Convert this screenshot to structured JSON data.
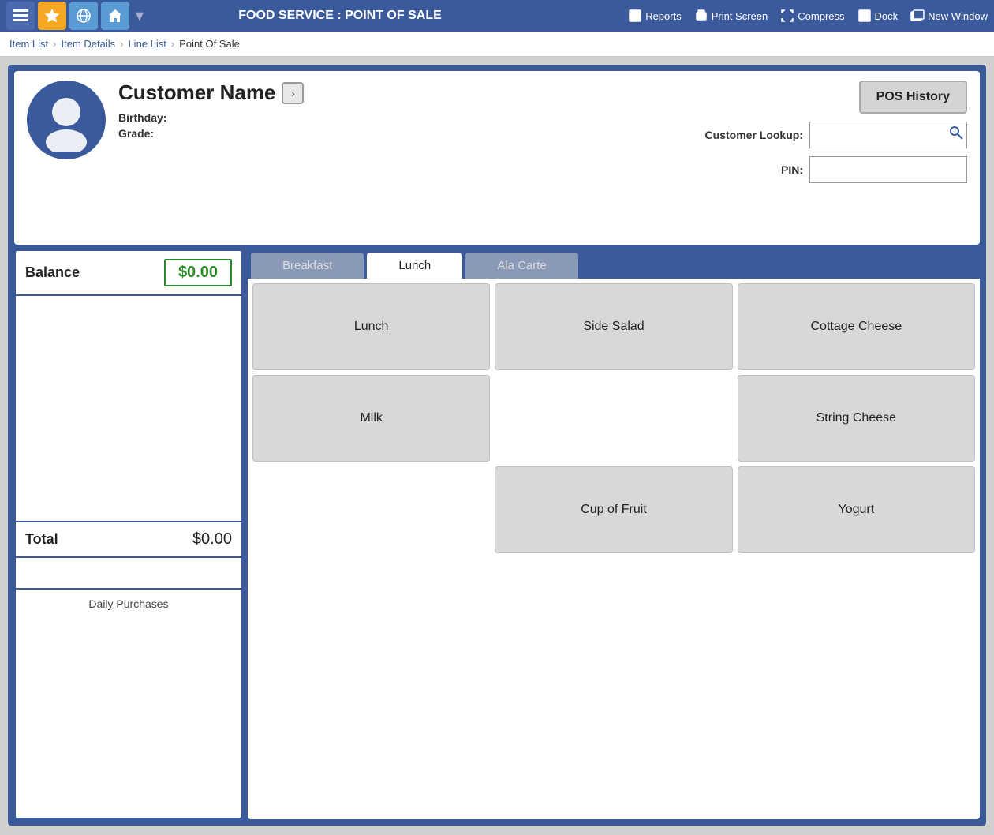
{
  "topbar": {
    "title": "FOOD SERVICE : POINT OF SALE",
    "actions": [
      {
        "id": "reports",
        "label": "Reports"
      },
      {
        "id": "print-screen",
        "label": "Print Screen"
      },
      {
        "id": "compress",
        "label": "Compress"
      },
      {
        "id": "dock",
        "label": "Dock"
      },
      {
        "id": "new-window",
        "label": "New Window"
      }
    ]
  },
  "breadcrumb": {
    "items": [
      "Item List",
      "Item Details",
      "Line List",
      "Point Of Sale"
    ]
  },
  "customer": {
    "name": "Customer Name",
    "birthday_label": "Birthday:",
    "birthday_value": "",
    "grade_label": "Grade:",
    "grade_value": "",
    "lookup_label": "Customer Lookup:",
    "pin_label": "PIN:",
    "pos_history_label": "POS History"
  },
  "left_panel": {
    "balance_label": "Balance",
    "balance_value": "$0.00",
    "total_label": "Total",
    "total_value": "$0.00",
    "daily_purchases_label": "Daily Purchases"
  },
  "tabs": [
    {
      "id": "breakfast",
      "label": "Breakfast",
      "active": false
    },
    {
      "id": "lunch",
      "label": "Lunch",
      "active": true
    },
    {
      "id": "ala-carte",
      "label": "Ala Carte",
      "active": false
    }
  ],
  "items": [
    {
      "id": "lunch",
      "label": "Lunch",
      "col": 1,
      "row": 1
    },
    {
      "id": "side-salad",
      "label": "Side Salad",
      "col": 2,
      "row": 1
    },
    {
      "id": "cottage-cheese",
      "label": "Cottage Cheese",
      "col": 3,
      "row": 1
    },
    {
      "id": "milk",
      "label": "Milk",
      "col": 1,
      "row": 2
    },
    {
      "id": "empty-2-2",
      "label": "",
      "col": 2,
      "row": 2,
      "empty": true
    },
    {
      "id": "string-cheese",
      "label": "String Cheese",
      "col": 3,
      "row": 2
    },
    {
      "id": "empty-3-1",
      "label": "",
      "col": 1,
      "row": 3,
      "empty": true
    },
    {
      "id": "cup-of-fruit",
      "label": "Cup of Fruit",
      "col": 2,
      "row": 3
    },
    {
      "id": "yogurt",
      "label": "Yogurt",
      "col": 3,
      "row": 3
    }
  ]
}
